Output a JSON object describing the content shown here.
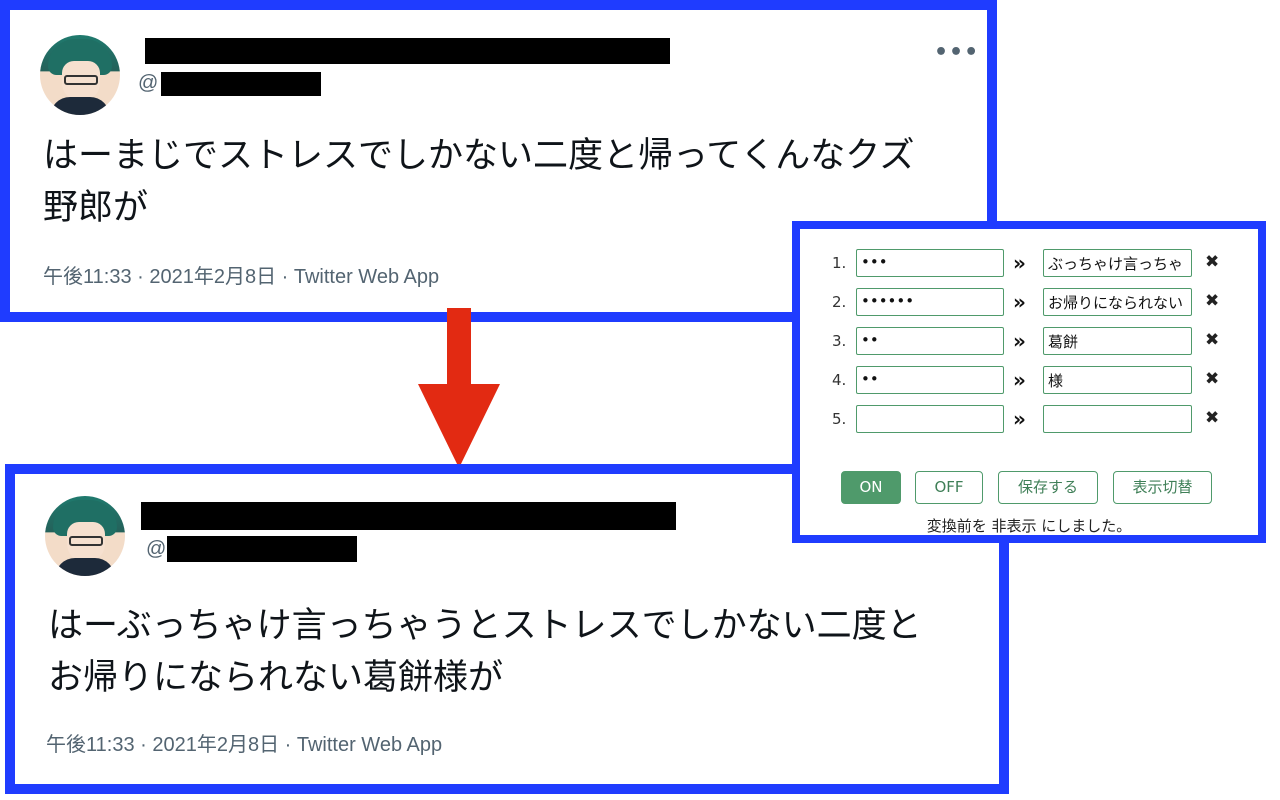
{
  "before_tweet": {
    "handle_prefix": "@",
    "more": "•••",
    "text": "はーまじでストレスでしかない二度と帰ってくんなクズ野郎が",
    "meta": "午後11:33 · 2021年2月8日 · Twitter Web App"
  },
  "after_tweet": {
    "handle_prefix": "@",
    "text": "はーぶっちゃけ言っちゃうとストレスでしかない二度とお帰りになられない葛餅様が",
    "meta": "午後11:33 · 2021年2月8日 · Twitter Web App"
  },
  "panel": {
    "rows": [
      {
        "num": "1.",
        "from": "•••",
        "to": "ぶっちゃけ言っちゃ"
      },
      {
        "num": "2.",
        "from": "••••••",
        "to": "お帰りになられない"
      },
      {
        "num": "3.",
        "from": "••",
        "to": "葛餅"
      },
      {
        "num": "4.",
        "from": "••",
        "to": "様"
      },
      {
        "num": "5.",
        "from": "",
        "to": ""
      }
    ],
    "arrow": "»",
    "delete": "✖",
    "buttons": {
      "on": "ON",
      "off": "OFF",
      "save": "保存する",
      "toggle": "表示切替"
    },
    "status": "変換前を 非表示 にしました。"
  },
  "colors": {
    "frame": "#1f3cff",
    "arrow": "#e22a12",
    "panel_accent": "#4f9a6b"
  }
}
